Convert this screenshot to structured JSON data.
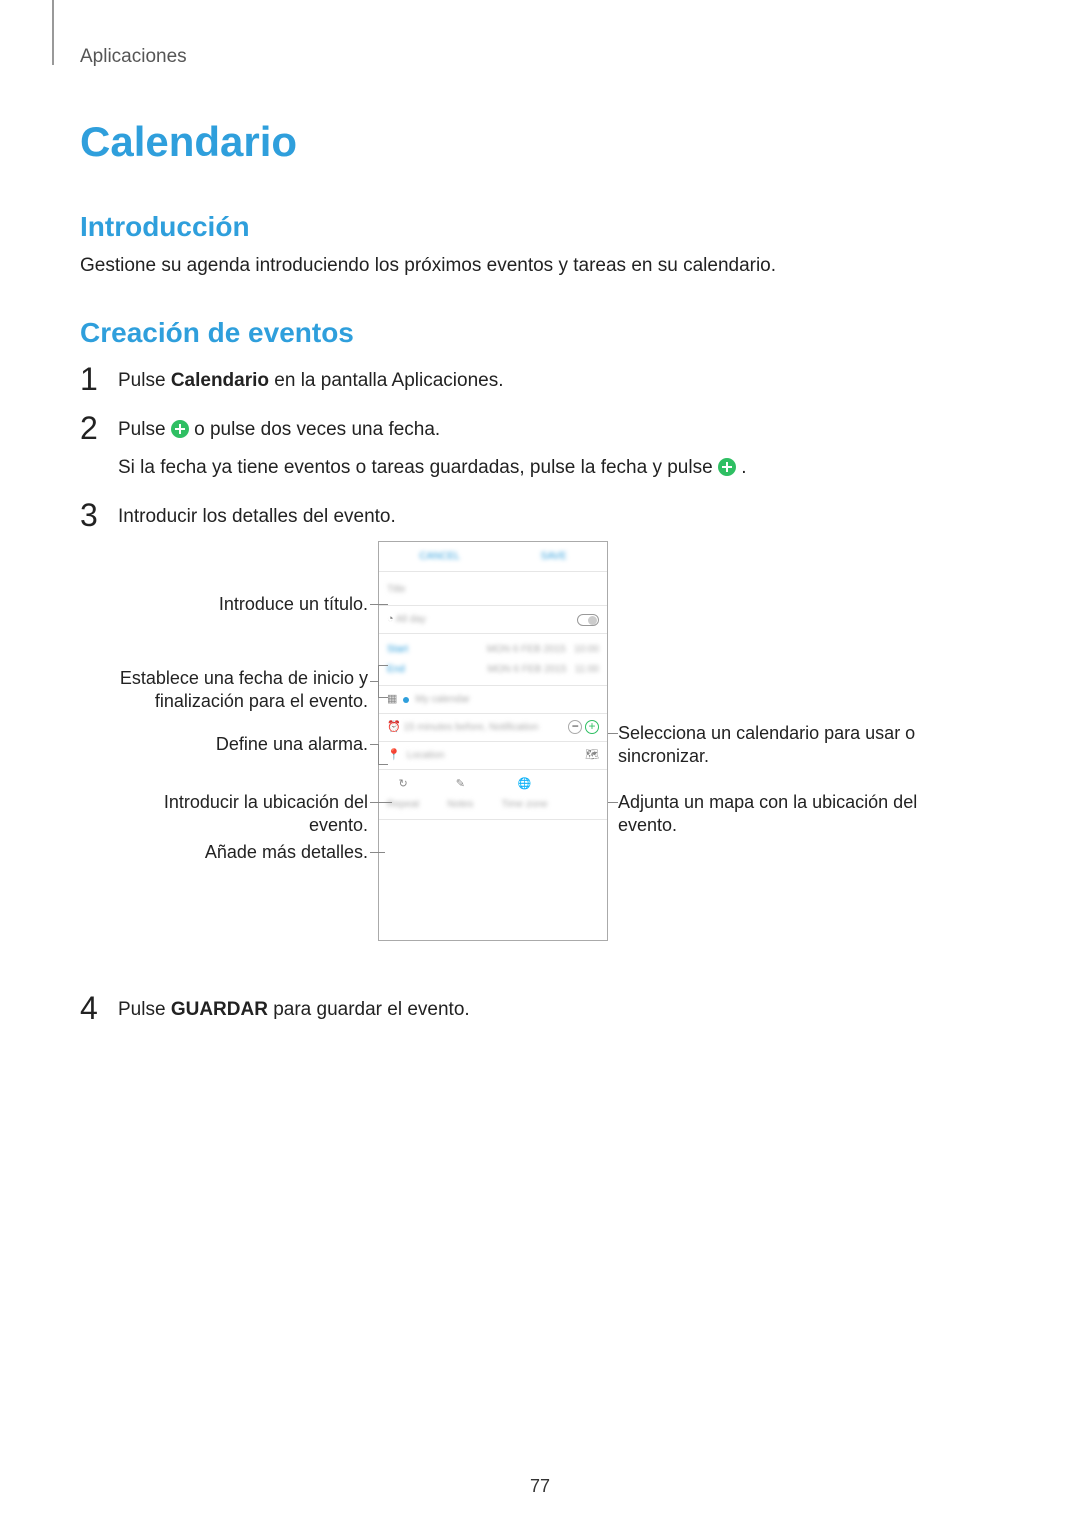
{
  "breadcrumb": "Aplicaciones",
  "title": "Calendario",
  "section_intro": "Introducción",
  "intro_text": "Gestione su agenda introduciendo los próximos eventos y tareas en su calendario.",
  "section_create": "Creación de eventos",
  "step1": {
    "prefix": "Pulse ",
    "bold": "Calendario",
    "suffix": " en la pantalla Aplicaciones."
  },
  "step2": {
    "line1_pre": "Pulse ",
    "line1_post": " o pulse dos veces una fecha.",
    "line2_pre": "Si la fecha ya tiene eventos o tareas guardadas, pulse la fecha y pulse ",
    "line2_post": "."
  },
  "step3": "Introducir los detalles del evento.",
  "step4": {
    "prefix": "Pulse ",
    "bold": "GUARDAR",
    "suffix": " para guardar el evento."
  },
  "labels": {
    "title_input": "Introduce un título.",
    "dates": "Establece una fecha de inicio y finalización para el evento.",
    "alarm": "Define una alarma.",
    "location": "Introducir la ubicación del evento.",
    "details": "Añade más detalles.",
    "calendar_select": "Selecciona un calendario para usar o sincronizar.",
    "map": "Adjunta un mapa con la ubicación del evento."
  },
  "page_number": "77"
}
